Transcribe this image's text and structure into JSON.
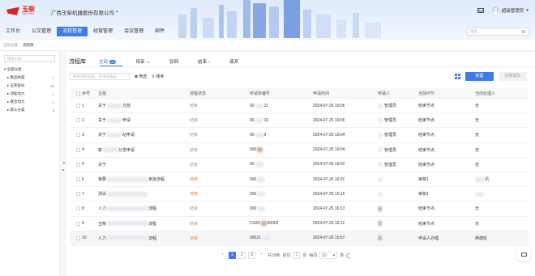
{
  "brand": {
    "logo_cn": "玉柴",
    "logo_en": "YUCHAI",
    "color": "#d7261e"
  },
  "company": {
    "name": "广西玉柴机器股份有限公司",
    "caret": "▾"
  },
  "user": {
    "name": "超级管理员",
    "caret": "▾"
  },
  "icons": {
    "mail": "mail-icon",
    "avatar": "user-avatar",
    "search": "search-icon",
    "filter": "funnel-icon",
    "sort": "sort-icon",
    "grid": "grid-view-icon",
    "refresh": "refresh-icon",
    "float": "message-icon"
  },
  "nav": [
    {
      "label": "工作台",
      "active": false
    },
    {
      "label": "公文管理",
      "active": false
    },
    {
      "label": "流程管理",
      "active": true
    },
    {
      "label": "经营管理",
      "active": false
    },
    {
      "label": "会议管理",
      "active": false
    },
    {
      "label": "邮件",
      "active": false
    }
  ],
  "header_search": {
    "placeholder": "搜索"
  },
  "breadcrumb": {
    "parent": "当前位置",
    "current": "流程库"
  },
  "sidebar": {
    "search_placeholder": "搜索分类",
    "items": [
      {
        "label": "▾ 全部分类",
        "count": "",
        "child": false
      },
      {
        "label": "▸ 集团本部",
        "count": "1",
        "child": true
      },
      {
        "label": "▸ 玉柴股份",
        "count": "26",
        "child": true
      },
      {
        "label": "▸ 动能动力",
        "count": "1",
        "child": true
      },
      {
        "label": "▸ 联合动力",
        "count": "1",
        "child": true
      },
      {
        "label": "▸ 默认分类",
        "count": "3",
        "child": true
      }
    ]
  },
  "collapse_arrows": {
    "left": "◂",
    "right": "▸"
  },
  "panel": {
    "title": "流程库"
  },
  "tabs": [
    {
      "label": "全部",
      "count": "29",
      "active": true
    },
    {
      "label": "待审",
      "count": "26",
      "active": false
    },
    {
      "label": "驳回",
      "count": "",
      "active": false
    },
    {
      "label": "结束",
      "count": "3",
      "active": false
    },
    {
      "label": "废弃",
      "count": "",
      "active": false
    }
  ],
  "toolbar": {
    "search_placeholder": "搜索流程标题、申请单编号",
    "filter_label": "筛选",
    "sort_label": "排序",
    "new_label": "新建",
    "batch_label": "批量删除"
  },
  "table": {
    "headers": [
      "序号",
      "主题",
      "流程状态",
      "申请单编号",
      "申请时间",
      "申请人",
      "当前环节",
      "当前处理人"
    ],
    "rows": [
      {
        "no": "1",
        "title": "关于",
        "title_tail": "方放",
        "status": "结束",
        "status_type": "done",
        "code": "00",
        "code_tail": "11",
        "time": "2024-07-25 19:06",
        "applicant": "管理员",
        "node": "结束节点",
        "handler": "无"
      },
      {
        "no": "2",
        "title": "关于",
        "title_tail": "申请",
        "status": "结束",
        "status_type": "done",
        "code": "00",
        "code_tail": "10",
        "time": "2024-07-25 19:06",
        "applicant": "管理员",
        "node": "结束节点",
        "handler": "无"
      },
      {
        "no": "3",
        "title": "关于",
        "title_tail": "站申请",
        "status": "结束",
        "status_type": "done",
        "code": "00",
        "code_tail": "9",
        "time": "2024-07-25 19:04",
        "applicant": "管理员",
        "node": "结束节点",
        "handler": "无"
      },
      {
        "no": "4",
        "title": "薪",
        "title_tail": "分发申请",
        "status": "结束",
        "status_type": "done",
        "code": "000",
        "code_tail": "",
        "time": "2024-07-25 19:04",
        "applicant": "管理员",
        "node": "结束节点",
        "handler": "无"
      },
      {
        "no": "5",
        "title": "关于",
        "title_tail": "",
        "status": "结束",
        "status_type": "done",
        "code": "00",
        "code_tail": "",
        "time": "2024-07-25 19:03",
        "applicant": "管理员",
        "node": "结束节点",
        "handler": "无"
      },
      {
        "no": "6",
        "title": "我要",
        "title_tail": "审批流程",
        "status": "待审",
        "status_type": "todo",
        "code": "000",
        "code_tail": "",
        "time": "2024-07-25 16:20",
        "applicant": "",
        "node": "审核1",
        "handler": "讯"
      },
      {
        "no": "7",
        "title": "测试",
        "title_tail": "",
        "status": "待审",
        "status_type": "todo",
        "code": "000",
        "code_tail": "",
        "time": "2024-07-25 16:16",
        "applicant": "",
        "node": "审核1",
        "handler": ""
      },
      {
        "no": "8",
        "title": "人力",
        "title_tail": "流程",
        "status": "结束",
        "status_type": "done",
        "code": "000",
        "code_tail": "",
        "time": "2024-07-25 16:13",
        "applicant": "",
        "node": "结束节点",
        "handler": "无"
      },
      {
        "no": "9",
        "title": "玉柴",
        "title_tail": "流程",
        "status": "结束",
        "status_type": "done",
        "code": "CS20",
        "code_tail": "00002",
        "time": "2024-07-25 16:10",
        "applicant": "",
        "node": "结束节点",
        "handler": "无"
      },
      {
        "no": "10",
        "title": "人力",
        "title_tail": "流程",
        "status": "待审",
        "status_type": "todo",
        "code": "00021",
        "code_tail": "",
        "time": "2024-07-25 15:57",
        "applicant": "",
        "node": "申请人办理",
        "handler": "杨德凯"
      }
    ]
  },
  "pagination": {
    "prev": "‹",
    "pages": [
      "1",
      "2",
      "3"
    ],
    "next": "›",
    "total": "共29条",
    "goto_prefix": "前往",
    "goto_value": "1",
    "goto_suffix": "页",
    "per_page_label": "每页",
    "per_page": "10",
    "per_page_caret": "▾",
    "unit": "条"
  },
  "colors": {
    "accent": "#3f7bea",
    "pending": "#e8893a",
    "done": "#999999"
  }
}
